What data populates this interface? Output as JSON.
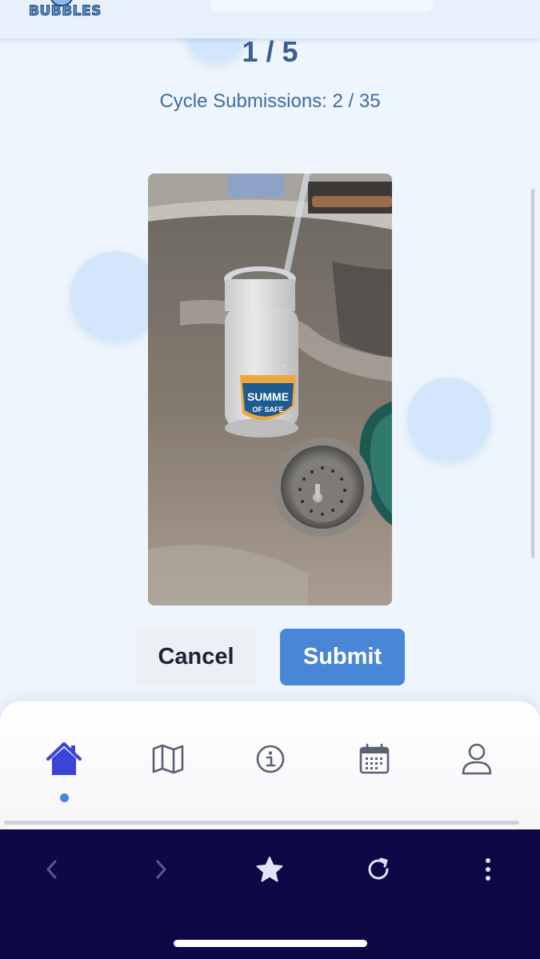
{
  "app": {
    "logo_text": "BUBBLES"
  },
  "submission": {
    "progress": "1 / 5",
    "cycle_label": "Cycle Submissions: 2 / 35",
    "photo_description": "Photo of a water bottle with 'SUMMER OF SAFETY' sticker being filled at a kitchen sink"
  },
  "photo_sticker": {
    "line1": "SUMME",
    "line2": "OF SAFE"
  },
  "actions": {
    "cancel_label": "Cancel",
    "submit_label": "Submit"
  },
  "bottom_nav": {
    "items": [
      {
        "icon": "home-icon",
        "active": true
      },
      {
        "icon": "map-icon",
        "active": false
      },
      {
        "icon": "info-icon",
        "active": false
      },
      {
        "icon": "calendar-icon",
        "active": false
      },
      {
        "icon": "profile-icon",
        "active": false
      }
    ]
  },
  "browser_toolbar": {
    "items": [
      "back-icon",
      "forward-icon",
      "bookmark-star-icon",
      "reload-icon",
      "more-icon"
    ]
  },
  "colors": {
    "accent": "#4a86d6",
    "nav_active": "#3b44d8",
    "nav_inactive": "#596273",
    "browser_bg": "#0d0846"
  }
}
